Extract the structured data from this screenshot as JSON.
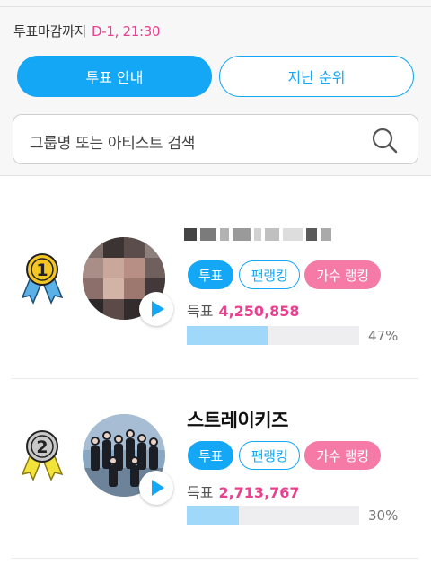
{
  "header": {
    "deadline_label": "투표마감까지",
    "deadline_value": "D-1, 21:30"
  },
  "tabs": {
    "vote_guide": "투표 안내",
    "past_ranking": "지난 순위"
  },
  "search": {
    "placeholder": "그룹명 또는 아티스트 검색"
  },
  "colors": {
    "accent_blue": "#14a7f5",
    "accent_pink": "#e8418f",
    "singer_pink": "#f57aa6",
    "bar_fill": "#9fd8f8"
  },
  "rankings": [
    {
      "rank": "1",
      "name": "",
      "buttons": {
        "vote": "투표",
        "fan": "팬랭킹",
        "singer": "가수 랭킹"
      },
      "votes_label": "득표",
      "votes": "4,250,858",
      "percent_label": "47%",
      "percent": 47,
      "medal_color": "#f3c622"
    },
    {
      "rank": "2",
      "name": "스트레이키즈",
      "buttons": {
        "vote": "투표",
        "fan": "팬랭킹",
        "singer": "가수 랭킹"
      },
      "votes_label": "득표",
      "votes": "2,713,767",
      "percent_label": "30%",
      "percent": 30,
      "medal_color": "#c9c9c9"
    }
  ]
}
